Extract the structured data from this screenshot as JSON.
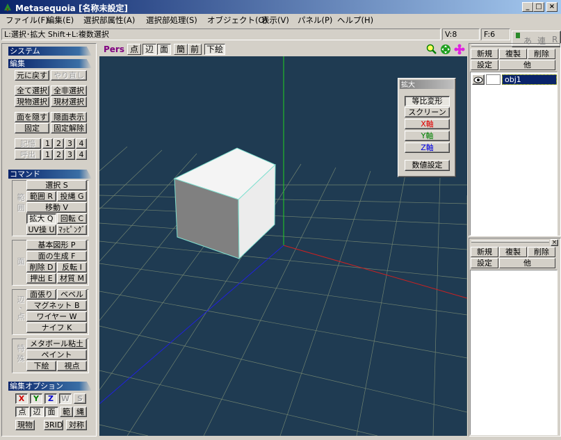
{
  "window": {
    "title": "Metasequoia [名称未設定]",
    "min": "_",
    "max": "□",
    "close": "×"
  },
  "menu": [
    "ファイル(F)",
    "編集(E)",
    "選択部属性(A)",
    "選択部処理(S)",
    "オブジェクト(O)",
    "表示(V)",
    "パネル(P)",
    "ヘルプ(H)"
  ],
  "status": {
    "hint": "L:選択･拡大  Shift+L:複数選択",
    "vertices": "V:8",
    "faces": "F:6",
    "ime": [
      "あ",
      "連",
      "R"
    ]
  },
  "sections": {
    "system": "システム",
    "edit": "編集",
    "command": "コマンド",
    "edit_option": "編集オプション"
  },
  "edit": {
    "undo": "元に戻す",
    "redo": "やり直し",
    "select_all": "全て選択",
    "deselect_all": "全非選択",
    "select_current_obj": "現物選択",
    "select_current_mat": "現材選択",
    "hide_face": "面を隠す",
    "show_hidden": "隠面表示",
    "fix": "固定",
    "unfix": "固定解除",
    "memory": "記憶",
    "recall": "呼出",
    "slots": [
      "1",
      "2",
      "3",
      "4"
    ]
  },
  "commands": {
    "range_label": "範囲",
    "face_label": "面",
    "edge_label": "辺･点",
    "special_label": "特殊",
    "select": "選択 S",
    "range": "範囲 R",
    "lasso": "投縄 G",
    "move": "移動 V",
    "scale": "拡大 Q",
    "rotate": "回転 C",
    "uv": "UV操 U",
    "mapping": "ﾏｯﾋﾟﾝｸﾞ",
    "primitive": "基本図形 P",
    "create_face": "面の生成 F",
    "delete": "削除 D",
    "flip": "反転 I",
    "extrude": "押出 E",
    "material": "材質 M",
    "face_stretch": "面張り",
    "bevel": "ベベル",
    "magnet": "マグネット B",
    "wire": "ワイヤー W",
    "knife": "ナイフ K",
    "metaball": "メタボール粘土",
    "paint": "ペイント",
    "underlay": "下絵",
    "viewpoint": "視点"
  },
  "edit_options": {
    "axes": [
      "X",
      "Y",
      "Z",
      "W",
      "S"
    ],
    "axis_colors": [
      "#d00000",
      "#008000",
      "#0000d0",
      "#808080",
      "#808080"
    ],
    "modes": [
      "点",
      "辺",
      "面",
      "範",
      "縄"
    ],
    "bottom": [
      "現物",
      "3RID",
      "対称"
    ]
  },
  "viewport": {
    "view_name": "Pers",
    "toolbar": [
      "点",
      "辺",
      "面",
      "簡",
      "前",
      "下絵"
    ],
    "icons": [
      "zoom-icon",
      "pan-icon",
      "rotate-icon"
    ]
  },
  "scale_panel": {
    "title": "拡大",
    "uniform": "等比変形",
    "screen": "スクリーン",
    "x_axis": "X軸",
    "y_axis": "Y軸",
    "z_axis": "Z軸",
    "numeric": "数値設定",
    "colors": {
      "x": "#e00000",
      "y": "#008000",
      "z": "#0000e0"
    }
  },
  "object_panel": {
    "new": "新規",
    "copy": "複製",
    "delete": "削除",
    "settings": "設定",
    "other": "他",
    "objects": [
      {
        "name": "obj1"
      }
    ]
  },
  "material_panel": {
    "new": "新規",
    "copy": "複製",
    "delete": "削除",
    "settings": "設定",
    "other": "他"
  }
}
